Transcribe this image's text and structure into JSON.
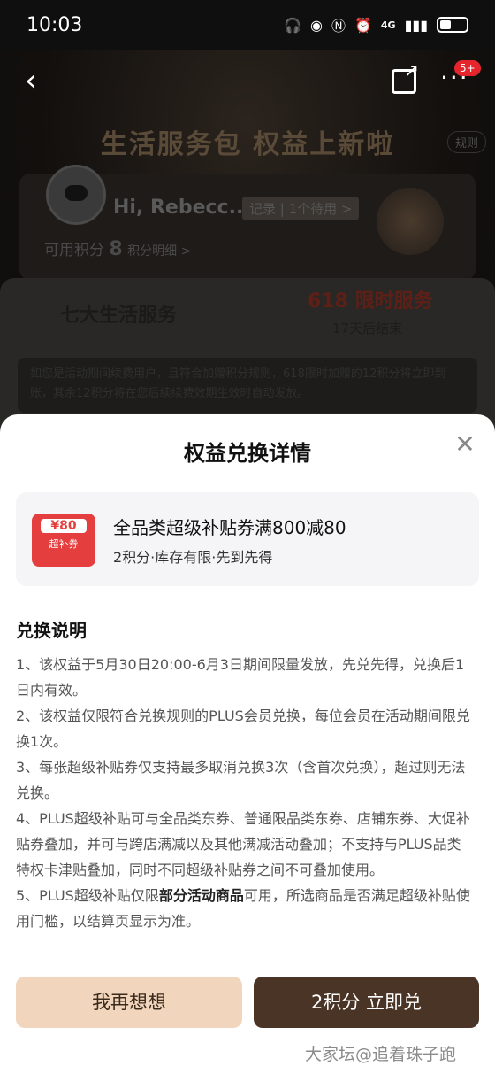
{
  "status": {
    "time": "10:03",
    "network": "4G"
  },
  "nav": {
    "back_icon": "chevron-left-icon",
    "share_icon": "share-icon",
    "more_icon": "more-icon",
    "badge": "5+"
  },
  "hero": {
    "headline": "生活服务包 权益上新啦",
    "rules_link": "规则",
    "user": {
      "greeting": "Hi, Rebecc...",
      "record": "记录 | 1个待用 >",
      "points_label": "可用积分",
      "points_value": "8",
      "points_detail": "积分明细 >"
    }
  },
  "services": {
    "title": "七大生活服务",
    "promo": "618 限时服务",
    "ends": "17天后结束",
    "note": "如您是活动期间续费用户，且符合加赠积分规则，618限时加赠的12积分将立即到账，其余12积分将在您后续续费效期生效时自动发放。"
  },
  "modal": {
    "title": "权益兑换详情",
    "close_icon": "close-icon",
    "coupon": {
      "icon_amount": "¥80",
      "icon_label": "超补券",
      "name": "全品类超级补贴券满800减80",
      "meta": "2积分·库存有限·先到先得"
    },
    "section_title": "兑换说明",
    "rules": [
      "1、该权益于5月30日20:00-6月3日期间限量发放，先兑先得，兑换后1日内有效。",
      "2、该权益仅限符合兑换规则的PLUS会员兑换，每位会员在活动期间限兑换1次。",
      "3、每张超级补贴券仅支持最多取消兑换3次（含首次兑换），超过则无法兑换。",
      "4、PLUS超级补贴可与全品类东券、普通限品类东券、店铺东券、大促补贴券叠加，并可与跨店满减以及其他满减活动叠加；不支持与PLUS品类特权卡津贴叠加，同时不同超级补贴券之间不可叠加使用。"
    ],
    "rule5_prefix": "5、PLUS超级补贴仅限",
    "rule5_highlight": "部分活动商品",
    "rule5_suffix": "可用，所选商品是否满足超级补贴使用门槛，以结算页显示为准。",
    "btn_think": "我再想想",
    "btn_redeem": "2积分 立即兑"
  },
  "watermark": "大家坛@追着珠子跑"
}
